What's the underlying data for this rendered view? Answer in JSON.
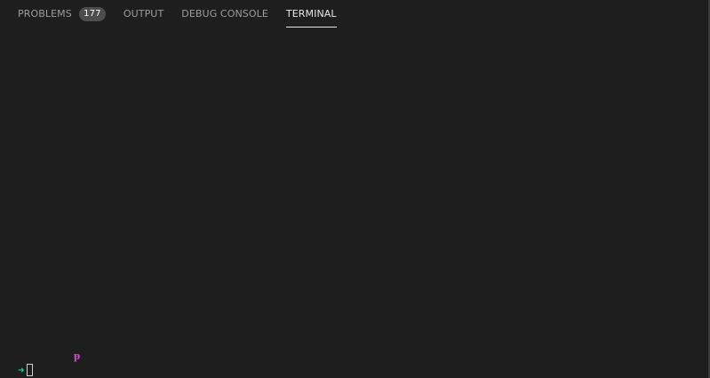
{
  "tabs": [
    {
      "label": "PROBLEMS",
      "badge": "177",
      "active": false
    },
    {
      "label": "OUTPUT",
      "active": false
    },
    {
      "label": "DEBUG CONSOLE",
      "active": false
    },
    {
      "label": "TERMINAL",
      "active": true
    }
  ],
  "terminal": {
    "git_glyph": "ᵽ",
    "prompt_arrow": "➜",
    "icons": {
      "git_branch": "git-branch-icon",
      "prompt_arrow": "prompt-arrow-icon",
      "cursor": "cursor-block"
    }
  },
  "colors": {
    "background": "#1e1e1e",
    "tab_inactive": "#9d9d9d",
    "tab_active": "#e7e7e7",
    "badge_bg": "#4d4d4d",
    "prompt_arrow": "#23d18b",
    "git_glyph": "#c84fcf"
  }
}
